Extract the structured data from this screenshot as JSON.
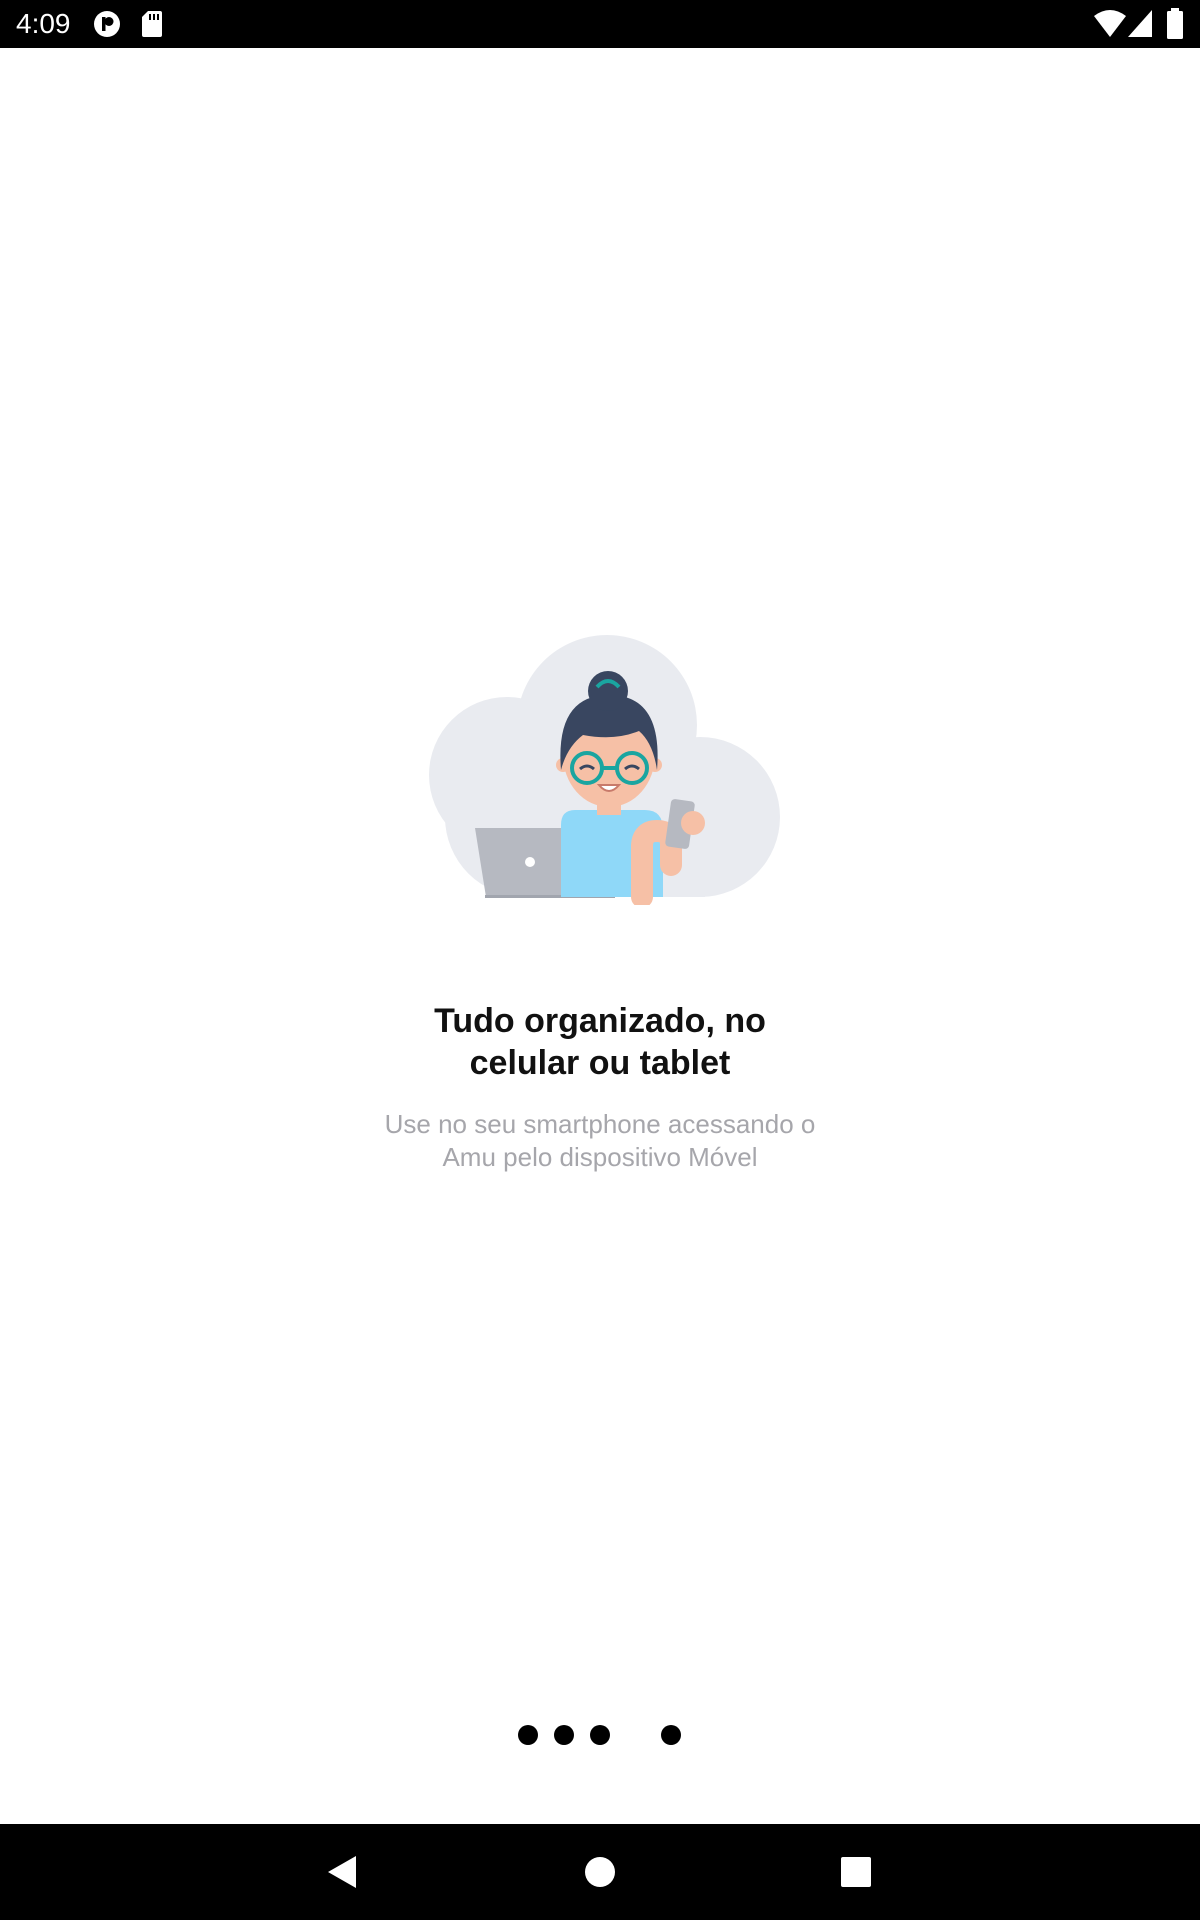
{
  "status_bar": {
    "time": "4:09",
    "left_icons": [
      "notification-p-icon",
      "sd-card-icon"
    ],
    "right_icons": [
      "wifi-icon",
      "cellular-signal-icon",
      "battery-icon"
    ]
  },
  "onboarding": {
    "illustration": "woman-with-laptop-and-phone-on-cloud",
    "title_line1": "Tudo organizado, no",
    "title_line2": "celular ou tablet",
    "subtitle_line1": "Use no seu smartphone acessando o",
    "subtitle_line2": "Amu pelo dispositivo Móvel"
  },
  "page_indicator": {
    "total": 4,
    "current": 4
  },
  "nav_bar": {
    "buttons": [
      "back-icon",
      "home-icon",
      "recents-icon"
    ]
  },
  "colors": {
    "title": "#111111",
    "subtitle": "#a6a6ab",
    "cloud": "#e9ebf0",
    "hair": "#394660",
    "shirt": "#8fd8f8",
    "skin": "#f6c0a6",
    "glasses": "#1aa5a0",
    "laptop": "#b6b9c1"
  }
}
